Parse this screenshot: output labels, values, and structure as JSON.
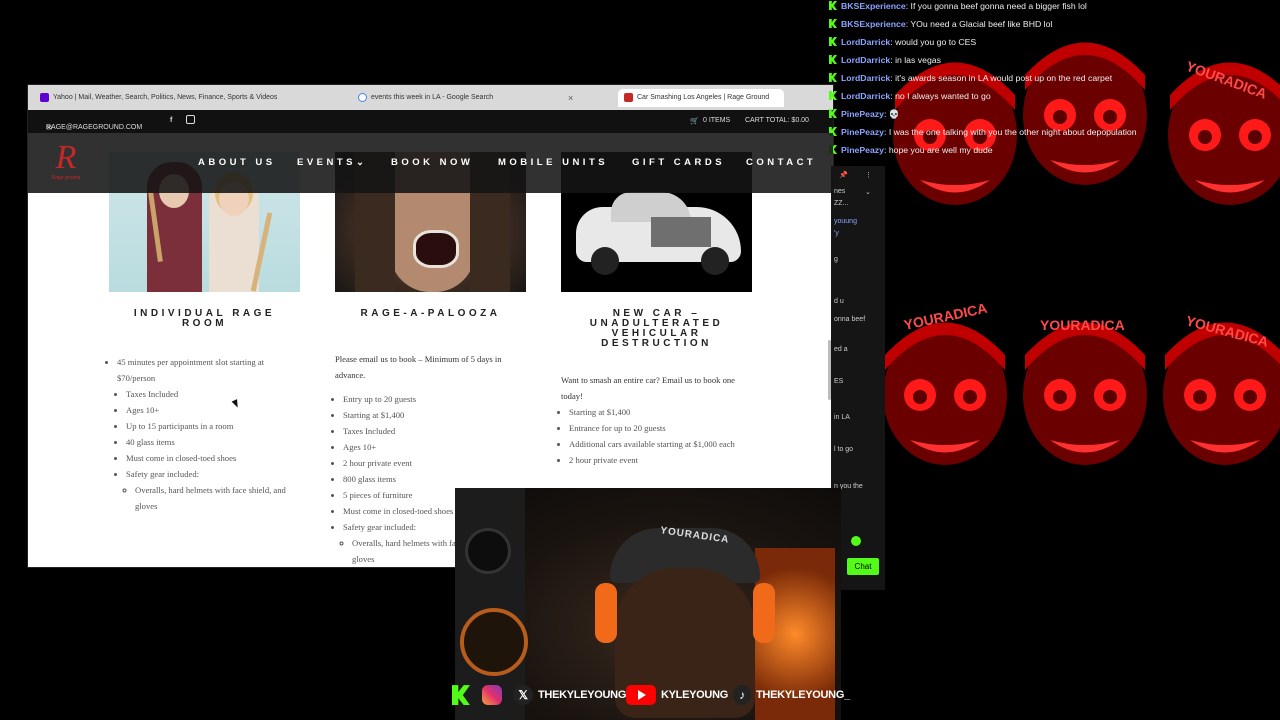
{
  "browser": {
    "tabs": [
      {
        "label": "Yahoo | Mail, Weather, Search, Politics, News, Finance, Sports & Videos",
        "active": false
      },
      {
        "label": "events this week in LA - Google Search",
        "active": false
      },
      {
        "label": "Car Smashing Los Angeles | Rage Ground",
        "active": true
      }
    ],
    "tab_close": "×"
  },
  "site": {
    "email": "RAGE@RAGEGROUND.COM",
    "cart_items": "0 ITEMS",
    "cart_total": "CART TOTAL: $0.00",
    "logo_letter": "R",
    "logo_sub": "Rage ground",
    "nav": [
      "ABOUT US",
      "EVENTS",
      "BOOK NOW",
      "MOBILE UNITS",
      "GIFT CARDS",
      "CONTACT"
    ],
    "cards": [
      {
        "title": "INDIVIDUAL RAGE ROOM",
        "intro": "",
        "items": [
          "45 minutes per appointment slot starting at $70/person",
          "Taxes Included",
          "Ages 10+",
          "Up to 15 participants in a room",
          "40 glass items",
          "Must come in closed-toed shoes",
          "Safety gear included:"
        ],
        "subitems": [
          "Overalls, hard helmets with face shield, and gloves"
        ]
      },
      {
        "title": "RAGE-A-PALOOZA",
        "intro": "Please email us to book – Minimum of 5 days in advance.",
        "items": [
          "Entry up to 20 guests",
          "Starting at $1,400",
          "Taxes Included",
          "Ages 10+",
          "2 hour private event",
          "800 glass items",
          "5 pieces of furniture",
          "Must come in closed-toed shoes",
          "Safety gear included:"
        ],
        "subitems": [
          "Overalls, hard helmets with face shield, and gloves"
        ]
      },
      {
        "title": "NEW CAR – UNADULTERATED VEHICULAR DESTRUCTION",
        "intro": "Want to smash an entire car? Email us to book one today!",
        "items": [
          "Starting at $1,400",
          "Entrance for up to 20 guests",
          "Additional cars available starting at $1,000 each",
          "2 hour private event"
        ],
        "subitems": []
      }
    ]
  },
  "chat": [
    {
      "user": "BKSExperience",
      "msg": "If you gonna beef gonna need a bigger fish lol"
    },
    {
      "user": "BKSExperience",
      "msg": "YOu need a Glacial beef like BHD lol"
    },
    {
      "user": "LordDarrick",
      "msg": "would you go to CES"
    },
    {
      "user": "LordDarrick",
      "msg": "in las vegas"
    },
    {
      "user": "LordDarrick",
      "msg": "it's awards season in LA would post up on the red carpet"
    },
    {
      "user": "LordDarrick",
      "msg": "no I always wanted to go"
    },
    {
      "user": "PinePeazy",
      "msg": "💀"
    },
    {
      "user": "PinePeazy",
      "msg": "I was the one talking with you the other night about depopulation"
    },
    {
      "user": "PinePeazy",
      "msg": "hope you are well my dude"
    }
  ],
  "side_panel": {
    "fragments": [
      "nes",
      "ZZ...",
      "youung",
      "'y",
      "g",
      "d u",
      "onna beef",
      "ed a",
      "ES",
      "in LA",
      "l to go",
      "n you the",
      "e"
    ],
    "chat_button": "Chat"
  },
  "emote": {
    "cap_text": "YOURADICA",
    "webcam_cap_text": "YOURADICA"
  },
  "socials": [
    {
      "platform": "kick",
      "handle": ""
    },
    {
      "platform": "instagram",
      "handle": ""
    },
    {
      "platform": "x",
      "handle": "THEKYLEYOUNG"
    },
    {
      "platform": "youtube",
      "handle": "KYLEYOUNG"
    },
    {
      "platform": "tiktok",
      "handle": "THEKYLEYOUNG_"
    }
  ],
  "colors": {
    "kick_green": "#53fc18",
    "chat_user": "#8ba4ff",
    "emote_red": "#c00000"
  }
}
